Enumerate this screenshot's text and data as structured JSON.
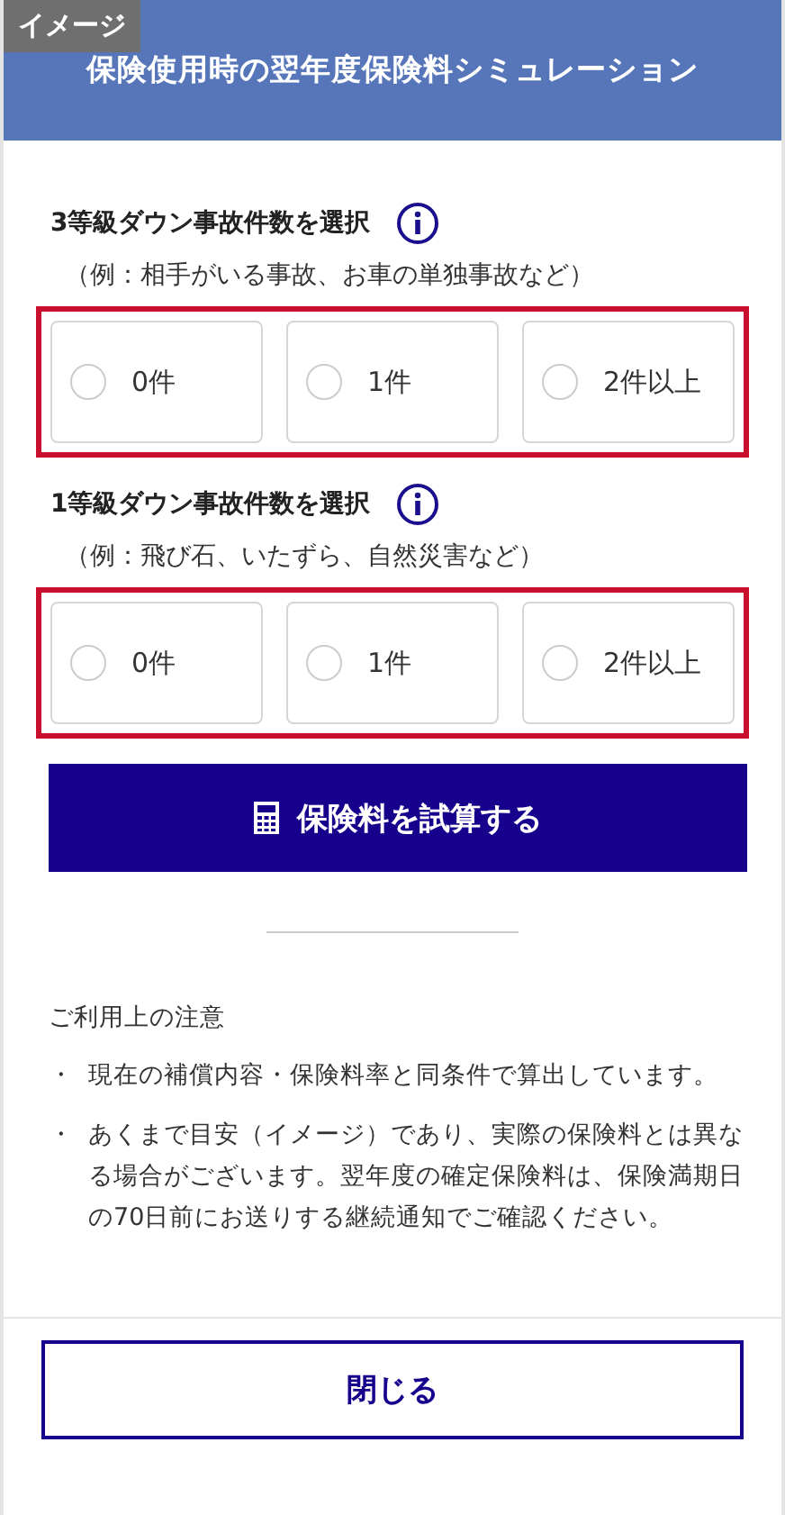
{
  "badge": "イメージ",
  "header": {
    "title": "保険使用時の翌年度保険料シミュレーション"
  },
  "questions": [
    {
      "label": "3等級ダウン事故件数を選択",
      "hint": "（例：相手がいる事故、お車の単独事故など）",
      "highlighted": true,
      "options": [
        {
          "label": "0件",
          "selected": false
        },
        {
          "label": "1件",
          "selected": false
        },
        {
          "label": "2件以上",
          "selected": false
        }
      ]
    },
    {
      "label": "1等級ダウン事故件数を選択",
      "hint": "（例：飛び石、いたずら、自然災害など）",
      "highlighted": true,
      "options": [
        {
          "label": "0件",
          "selected": false
        },
        {
          "label": "1件",
          "selected": false
        },
        {
          "label": "2件以上",
          "selected": false
        }
      ]
    }
  ],
  "calculate_button": "保険料を試算する",
  "notes": {
    "title": "ご利用上の注意",
    "items": [
      {
        "bullet": "・",
        "text": "現在の補償内容・保険料率と同条件で算出しています。"
      },
      {
        "bullet": "・",
        "text": "あくまで目安（イメージ）であり、実際の保険料とは異なる場合がございます。翌年度の確定保険料は、保険満期日の70日前にお送りする継続通知でご確認ください。"
      }
    ]
  },
  "close_button": "閉じる"
}
